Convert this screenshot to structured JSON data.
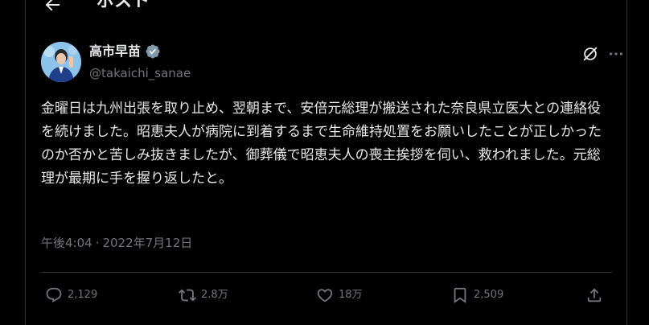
{
  "header": {
    "title": "ポスト"
  },
  "author": {
    "display_name": "高市早苗",
    "handle": "@takaichi_sanae",
    "verified": true
  },
  "post": {
    "text": "金曜日は九州出張を取り止め、翌朝まで、安倍元総理が搬送された奈良県立医大との連絡役を続けました。昭恵夫人が病院に到着するまで生命維持処置をお願いしたことが正しかったのか否かと苦しみ抜きましたが、御葬儀で昭恵夫人の喪主挨拶を伺い、救われました。元総理が最期に手を握り返したと。",
    "time": "午後4:04",
    "separator": "·",
    "date": "2022年7月12日"
  },
  "actions": {
    "replies": "2,129",
    "reposts": "2.8万",
    "likes": "18万",
    "bookmarks": "2,509"
  },
  "icons": {
    "back": "arrow-left-icon",
    "verified": "verified-badge-icon",
    "grok": "grok-icon",
    "more": "more-horizontal-icon",
    "reply": "reply-icon",
    "repost": "repost-icon",
    "like": "heart-icon",
    "bookmark": "bookmark-icon",
    "share": "share-icon"
  },
  "colors": {
    "background": "#000000",
    "text": "#e7e9ea",
    "secondary": "#71767b",
    "border": "#2f3336",
    "verified_badge": "#829aab"
  }
}
